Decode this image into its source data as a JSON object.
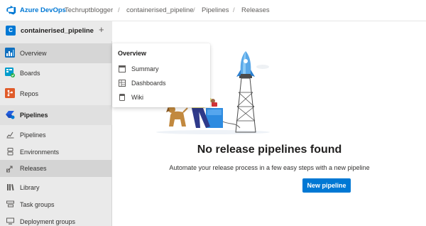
{
  "header": {
    "brand": "Azure DevOps",
    "breadcrumbs": [
      "Techruptblogger",
      "containerised_pipeline",
      "Pipelines",
      "Releases"
    ],
    "separator": "/"
  },
  "project": {
    "avatar_letter": "C",
    "name": "containerised_pipeline",
    "add_glyph": "+"
  },
  "sidebar": {
    "items": [
      {
        "label": "Overview",
        "icon": "overview-icon"
      },
      {
        "label": "Boards",
        "icon": "boards-icon"
      },
      {
        "label": "Repos",
        "icon": "repos-icon"
      },
      {
        "label": "Pipelines",
        "icon": "pipelines-icon"
      }
    ],
    "pipeline_sub": [
      {
        "label": "Pipelines",
        "icon": "pipelines-sub-icon"
      },
      {
        "label": "Environments",
        "icon": "environments-icon"
      },
      {
        "label": "Releases",
        "icon": "releases-icon"
      },
      {
        "label": "Library",
        "icon": "library-icon"
      },
      {
        "label": "Task groups",
        "icon": "task-groups-icon"
      },
      {
        "label": "Deployment groups",
        "icon": "deployment-groups-icon"
      }
    ]
  },
  "flyout": {
    "title": "Overview",
    "items": [
      {
        "label": "Summary",
        "icon": "summary-icon"
      },
      {
        "label": "Dashboards",
        "icon": "dashboards-icon"
      },
      {
        "label": "Wiki",
        "icon": "wiki-icon"
      }
    ]
  },
  "main": {
    "empty_title": "No release pipelines found",
    "empty_subtitle": "Automate your release process in a few easy steps with a new pipeline",
    "new_button": "New pipeline"
  },
  "colors": {
    "accent": "#0078d4",
    "sidebar_bg": "#eaeaea"
  }
}
